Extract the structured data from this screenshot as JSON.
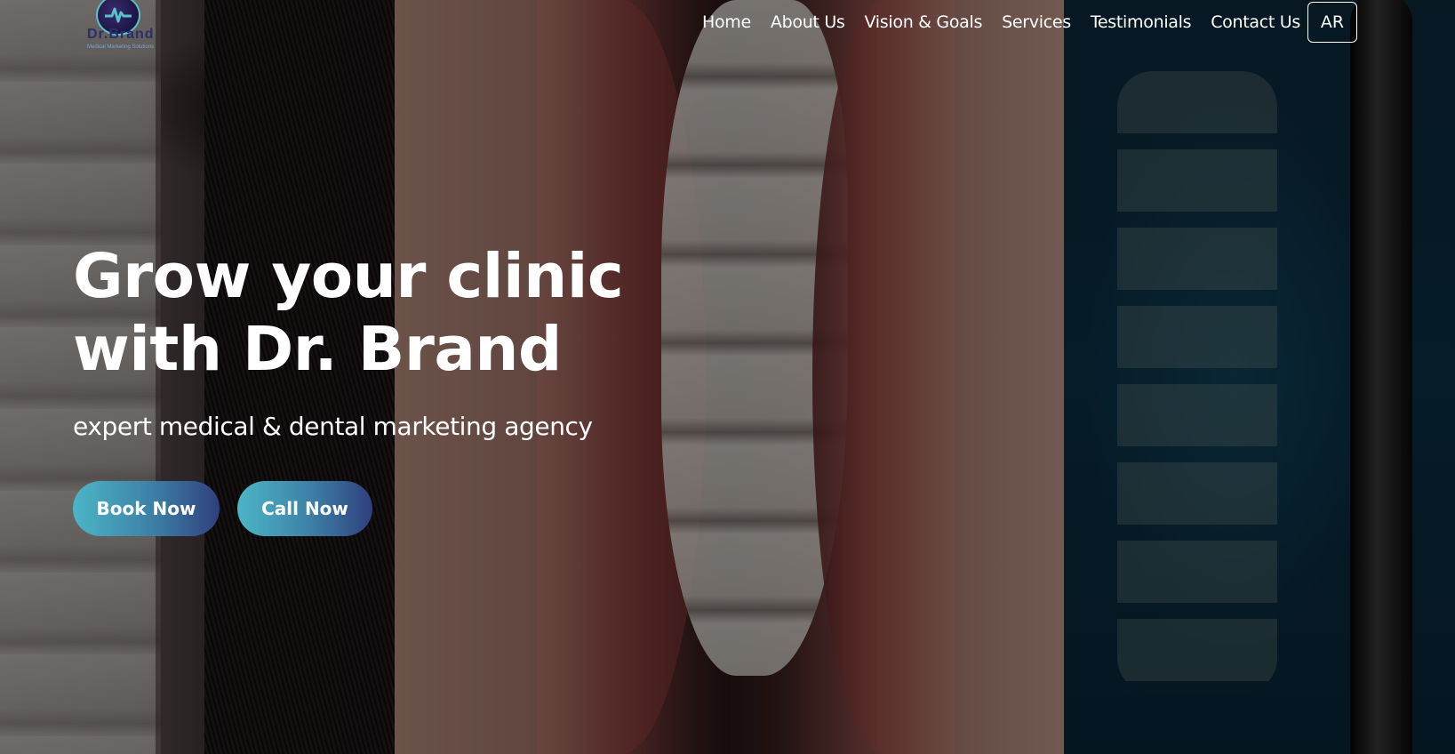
{
  "brand": {
    "logo_word": "Dr.Brand",
    "tagline": "Medical Marketing Solutions"
  },
  "nav": {
    "items": [
      "Home",
      "About Us",
      "Vision & Goals",
      "Services",
      "Testimonials",
      "Contact Us"
    ],
    "language_toggle": "AR"
  },
  "hero": {
    "headline_line1": "Grow your clinic",
    "headline_line2": "with Dr. Brand",
    "subline": "expert medical & dental marketing agency",
    "book_button": "Book Now",
    "call_button": "Call Now"
  },
  "colors": {
    "accent_gradient_start": "#4bb6c6",
    "accent_gradient_end": "#2f3f7e",
    "text": "#ffffff"
  }
}
